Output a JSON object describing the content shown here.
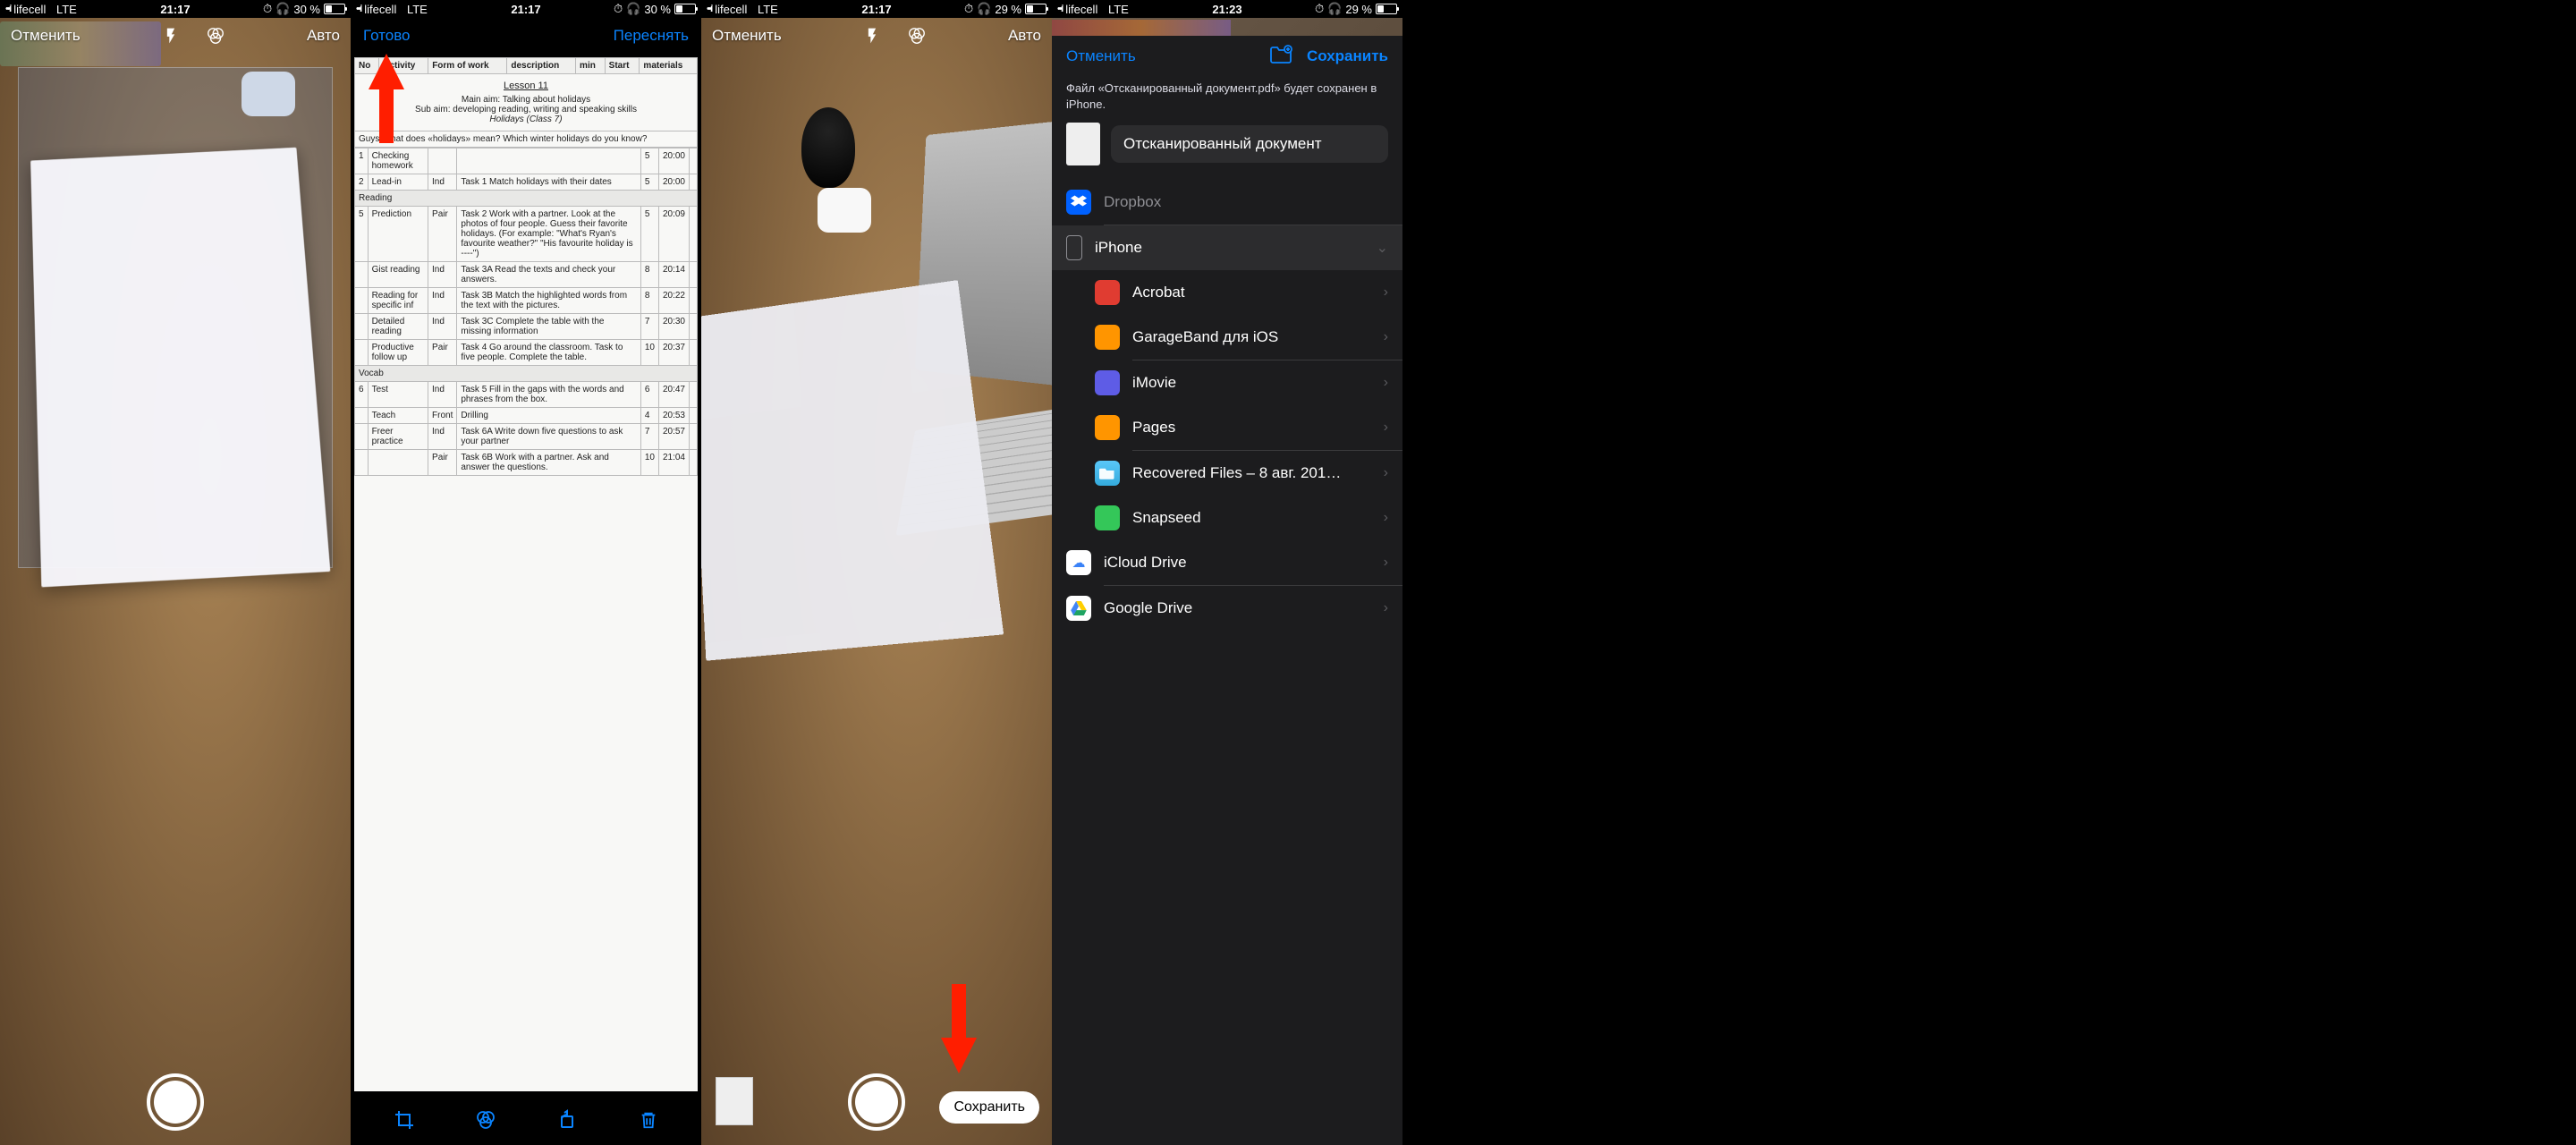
{
  "status": {
    "carrier": "lifecell",
    "net": "LTE",
    "t1": "21:17",
    "t2": "21:17",
    "t3": "21:17",
    "t4": "21:23",
    "hp": "30 %",
    "hp2": "29 %"
  },
  "cam": {
    "cancel": "Отменить",
    "auto": "Авто",
    "save": "Сохранить"
  },
  "edit": {
    "done": "Готово",
    "retake": "Переснять"
  },
  "doc": {
    "h1": "No",
    "h2": "Activity",
    "h3": "Form of work",
    "h4": "description",
    "h5": "min",
    "h6": "Start",
    "h7": "materials",
    "title": "Lesson 11",
    "aim1": "Main aim: Talking about holidays",
    "aim2": "Sub aim: developing reading, writing and speaking skills",
    "hol": "Holidays (Class 7)",
    "q": "Guys, what does «holidays» mean? Which winter holidays do you know?",
    "rows": [
      {
        "n": "1",
        "a": "Checking homework",
        "f": "",
        "d": "",
        "m": "5",
        "s": "20:00"
      },
      {
        "n": "2",
        "a": "Lead-in",
        "f": "Ind",
        "d": "Task 1 Match holidays with their dates",
        "m": "5",
        "s": "20:00"
      },
      {
        "sect": "Reading"
      },
      {
        "n": "5",
        "a": "Prediction",
        "f": "Pair",
        "d": "Task 2 Work with a partner. Look at the photos of four people. Guess their favorite holidays. (For example: \"What's Ryan's favourite weather?\" \"His favourite holiday is ----\")",
        "m": "5",
        "s": "20:09"
      },
      {
        "n": "",
        "a": "Gist reading",
        "f": "Ind",
        "d": "Task 3A Read the texts and check your answers.",
        "m": "8",
        "s": "20:14"
      },
      {
        "n": "",
        "a": "Reading for specific inf",
        "f": "Ind",
        "d": "Task 3B Match the highlighted words from the text with the pictures.",
        "m": "8",
        "s": "20:22"
      },
      {
        "n": "",
        "a": "Detailed reading",
        "f": "Ind",
        "d": "Task 3C Complete the table with the missing information",
        "m": "7",
        "s": "20:30"
      },
      {
        "n": "",
        "a": "Productive follow up",
        "f": "Pair",
        "d": "Task 4 Go around the classroom. Task to five people. Complete the table.",
        "m": "10",
        "s": "20:37"
      },
      {
        "sect": "Vocab"
      },
      {
        "n": "6",
        "a": "Test",
        "f": "Ind",
        "d": "Task 5 Fill in the gaps with the words and phrases from the box.",
        "m": "6",
        "s": "20:47"
      },
      {
        "n": "",
        "a": "Teach",
        "f": "Front",
        "d": "Drilling",
        "m": "4",
        "s": "20:53"
      },
      {
        "n": "",
        "a": "Freer practice",
        "f": "Ind",
        "d": "Task 6A Write down five questions to ask your partner",
        "m": "7",
        "s": "20:57"
      },
      {
        "n": "",
        "a": "",
        "f": "Pair",
        "d": "Task 6B Work with a partner. Ask and answer the questions.",
        "m": "10",
        "s": "21:04"
      }
    ]
  },
  "save": {
    "cancel": "Отменить",
    "save": "Сохранить",
    "msg": "Файл «Отсканированный документ.pdf» будет сохранен в iPhone.",
    "name": "Отсканированный документ",
    "dropbox": "Dropbox",
    "iphone": "iPhone",
    "items": [
      {
        "label": "Acrobat",
        "color": "#e03c31"
      },
      {
        "label": "GarageBand для iOS",
        "color": "#ff9500"
      },
      {
        "label": "iMovie",
        "color": "#5e5ce6"
      },
      {
        "label": "Pages",
        "color": "#ff9500"
      },
      {
        "label": "Recovered Files – 8 авг. 201…",
        "color": ""
      },
      {
        "label": "Snapseed",
        "color": "#34c759"
      }
    ],
    "icloud": "iCloud Drive",
    "gdrive": "Google Drive"
  }
}
